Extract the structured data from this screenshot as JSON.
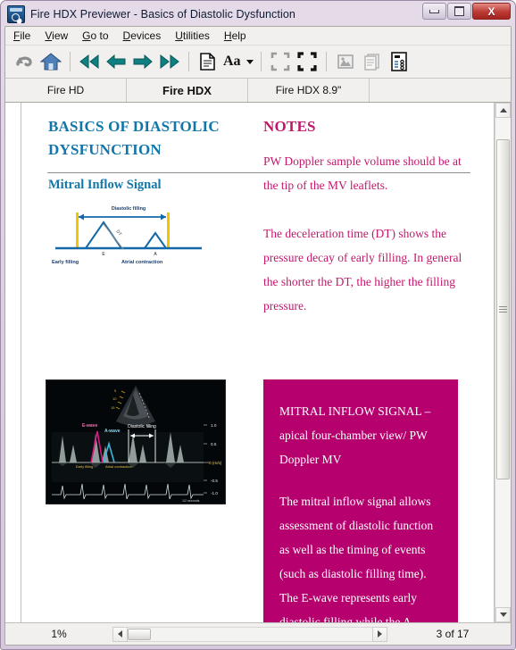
{
  "window": {
    "title": "Fire HDX Previewer - Basics of Diastolic Dysfunction",
    "app_icon": "previewer-app-icon",
    "minimize_label": "",
    "maximize_label": "",
    "close_label": "X"
  },
  "menu": [
    {
      "acc": "F",
      "rest": "ile"
    },
    {
      "acc": "V",
      "rest": "iew"
    },
    {
      "acc": "G",
      "rest": "o to"
    },
    {
      "acc": "D",
      "rest": "evices"
    },
    {
      "acc": "U",
      "rest": "tilities"
    },
    {
      "acc": "H",
      "rest": "elp"
    }
  ],
  "toolbar": {
    "items": [
      {
        "name": "back-undo-button",
        "icon": "undo-arrow-icon",
        "enabled": false
      },
      {
        "name": "home-button",
        "icon": "home-icon",
        "enabled": true
      },
      {
        "name": "first-page-button",
        "icon": "skip-back-icon",
        "enabled": true
      },
      {
        "name": "previous-page-button",
        "icon": "arrow-left-icon",
        "enabled": true
      },
      {
        "name": "next-page-button",
        "icon": "arrow-right-icon",
        "enabled": true
      },
      {
        "name": "last-page-button",
        "icon": "skip-forward-icon",
        "enabled": true
      },
      {
        "name": "page-layout-button",
        "icon": "document-pages-icon",
        "enabled": true
      },
      {
        "name": "font-size-button",
        "icon": "font-size-icon",
        "enabled": true
      },
      {
        "name": "fit-page-button",
        "icon": "fit-page-icon",
        "enabled": false
      },
      {
        "name": "fit-width-button",
        "icon": "fit-width-icon",
        "enabled": true
      },
      {
        "name": "images-button",
        "icon": "image-icon",
        "enabled": false
      },
      {
        "name": "text-button",
        "icon": "text-pages-icon",
        "enabled": false
      },
      {
        "name": "log-button",
        "icon": "log-report-icon",
        "enabled": true
      }
    ],
    "font_size_label": "Aa"
  },
  "tabs": [
    {
      "label": "Fire HD",
      "active": false
    },
    {
      "label": "Fire HDX",
      "active": true
    },
    {
      "label": "Fire HDX 8.9\"",
      "active": false
    }
  ],
  "document": {
    "left_column": {
      "title": "BASICS OF DIASTOLIC DYSFUNCTION",
      "section_heading": "Mitral Inflow Signal",
      "wave_diagram": {
        "name": "mitral-inflow-wave-diagram",
        "top_label": "Diastolic filling",
        "peak_labels": [
          "E",
          "A"
        ],
        "bottom_labels": [
          "Early filling",
          "Atrial contraction"
        ],
        "slope_label": "DT"
      },
      "echo_image": {
        "name": "echocardiogram-doppler-image",
        "labels": [
          "E-wave",
          "A-wave",
          "Diastolic filling",
          "Early filling",
          "Atrial contraction"
        ],
        "scale_ticks": [
          "1.0",
          "0.5",
          "0 (m/s)",
          "-0.5",
          "-1.0"
        ],
        "footer": "1/2 seconds"
      }
    },
    "right_column": {
      "title": "NOTES",
      "notes": [
        "PW Doppler sample volume should be at the tip of the MV leaflets.",
        "The deceleration time (DT) shows the pressure decay of early filling. In general the shorter the DT, the higher the filling pressure."
      ],
      "callout": {
        "heading": "MITRAL INFLOW SIGNAL – apical four-chamber view/ PW Doppler MV",
        "body": "The mitral inflow signal allows assessment of diastolic function as well as the timing of events (such as diastolic filling time). The E-wave represents early diastolic filling while the A-",
        "background": "#b5006e"
      }
    }
  },
  "status": {
    "zoom": "1%",
    "page_indicator": "3 of 17"
  },
  "colors": {
    "heading_blue": "#1276a8",
    "magenta": "#c2186c",
    "callout_bg": "#b5006e",
    "close_button_red": "#bc3a34"
  }
}
